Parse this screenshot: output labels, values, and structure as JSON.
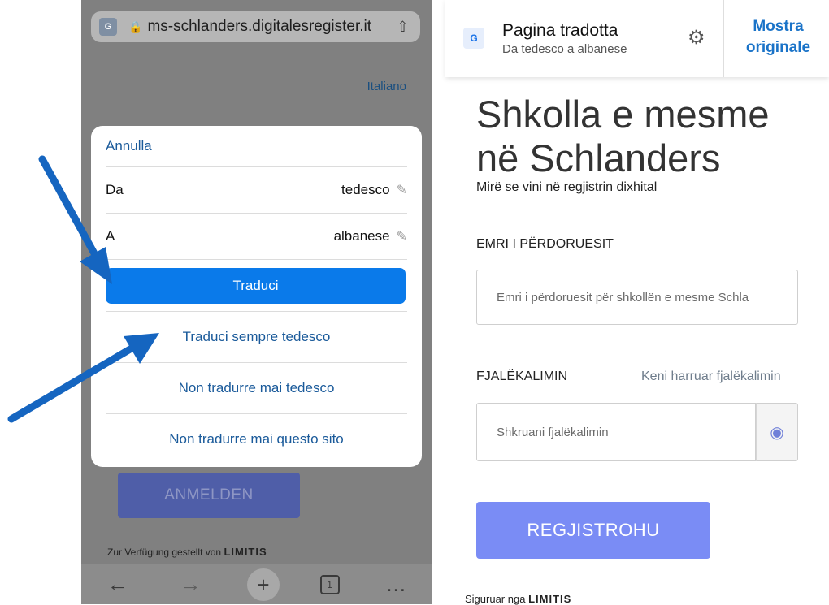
{
  "left": {
    "url": "ms-schlanders.digitalesregister.it",
    "language_link": "Italiano",
    "sheet": {
      "cancel": "Annulla",
      "from_label": "Da",
      "from_value": "tedesco",
      "to_label": "A",
      "to_value": "albanese",
      "translate": "Traduci",
      "always_translate": "Traduci sempre tedesco",
      "never_translate_lang": "Non tradurre mai tedesco",
      "never_translate_site": "Non tradurre mai questo sito"
    },
    "login_button": "ANMELDEN",
    "provided_by": "Zur Verfügung gestellt von",
    "brand": "LIMITIS",
    "toolbar": {
      "tab_count": "1"
    }
  },
  "right": {
    "translate_bar": {
      "title": "Pagina tradotta",
      "subtitle": "Da tedesco a albanese",
      "show_original_line1": "Mostra",
      "show_original_line2": "originale"
    },
    "school_title_line1": "Shkolla e mesme",
    "school_title_line2": "në Schlanders",
    "welcome": "Mirë se vini në regjistrin dixhital",
    "username_label": "EMRI I PËRDORUESIT",
    "username_placeholder": "Emri i përdoruesit për shkollën e mesme Schla",
    "password_label": "FJALËKALIMIN",
    "forgot_link": "Keni harruar fjalëkalimin",
    "password_placeholder": "Shkruani fjalëkalimin",
    "register_button": "REGJISTROHU",
    "secured_by": "Siguruar nga",
    "brand": "LIMITIS"
  },
  "colors": {
    "accent_blue": "#0a7aea",
    "arrow_blue": "#1565c0",
    "register_button": "#7a8cf5"
  }
}
